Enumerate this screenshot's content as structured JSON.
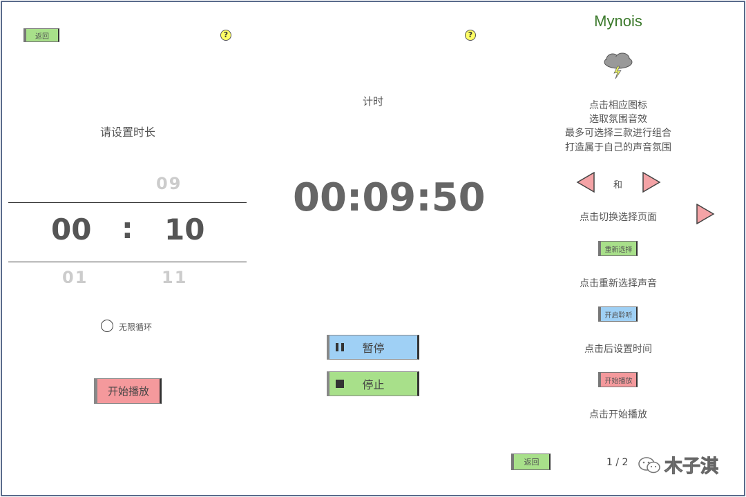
{
  "panel1": {
    "back_label": "返回",
    "help_label": "?",
    "prompt": "请设置时长",
    "picker": {
      "above_minutes": "",
      "above_seconds": "09",
      "minutes": "00",
      "separator": ":",
      "seconds": "10",
      "below_minutes": "01",
      "below_seconds": "11"
    },
    "loop_label": "无限循环",
    "start_label": "开始播放"
  },
  "panel2": {
    "help_label": "?",
    "title": "计时",
    "timer": "00:09:50",
    "pause_label": "暂停",
    "stop_label": "停止"
  },
  "panel3": {
    "app_title": "Mynois",
    "icon": "thunder-cloud-icon",
    "instructions": [
      "点击相应图标",
      "选取氛围音效",
      "最多可选择三款进行组合",
      "打造属于自己的声音氛围"
    ],
    "and_label": "和",
    "switch_text": "点击切换选择页面",
    "reselect_button": "重新选择",
    "reselect_text": "点击重新选择声音",
    "listen_button": "开启聆听",
    "listen_text": "点击后设置时间",
    "start_button": "开始播放",
    "start_text": "点击开始播放",
    "back_label": "返回",
    "page_indicator": "1 / 2",
    "watermark": "木子淇"
  },
  "colors": {
    "green_button": "#a8e08a",
    "blue_button": "#9fd0f5",
    "red_button": "#f4999c",
    "title_green": "#3c7a2c"
  }
}
